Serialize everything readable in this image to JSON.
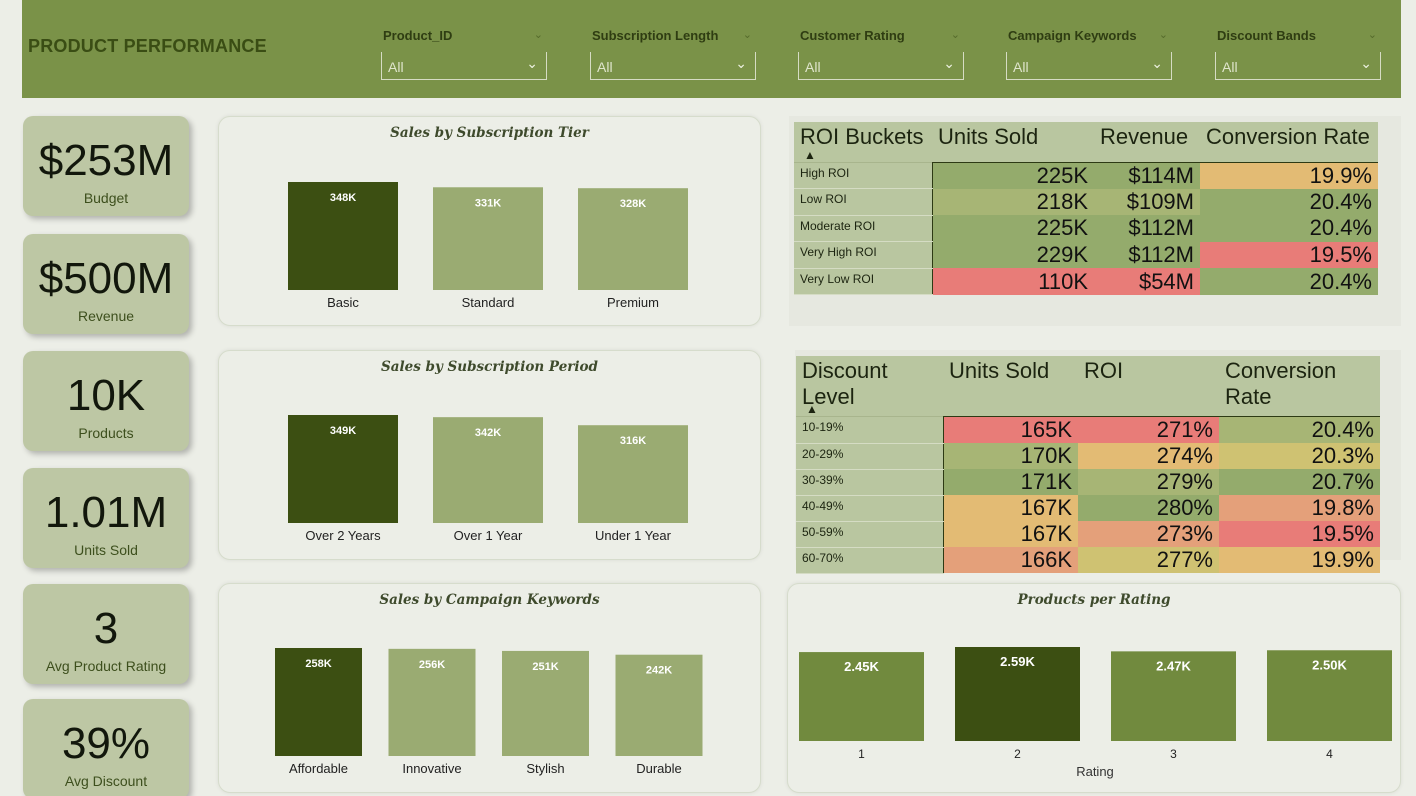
{
  "header": {
    "title": "PRODUCT PERFORMANCE",
    "slicers": [
      {
        "label": "Product_ID",
        "value": "All"
      },
      {
        "label": "Subscription Length",
        "value": "All"
      },
      {
        "label": "Customer Rating",
        "value": "All"
      },
      {
        "label": "Campaign Keywords",
        "value": "All"
      },
      {
        "label": "Discount Bands",
        "value": "All"
      }
    ]
  },
  "kpis": [
    {
      "value": "$253M",
      "label": "Budget"
    },
    {
      "value": "$500M",
      "label": "Revenue"
    },
    {
      "value": "10K",
      "label": "Products"
    },
    {
      "value": "1.01M",
      "label": "Units Sold"
    },
    {
      "value": "3",
      "label": "Avg Product Rating"
    },
    {
      "value": "39%",
      "label": "Avg Discount"
    }
  ],
  "colors": {
    "header": "#7a9248",
    "bar_dark": "#3c4f12",
    "bar_light": "#9aab72",
    "bar_rating": "#718a3e",
    "kpi_card": "#bdc7a4",
    "heat_green": "#94ab6c",
    "heat_olive": "#a7b575",
    "heat_orange": "#e3bb74",
    "heat_red": "#e87c78",
    "heat_salmon": "#e4a07a",
    "heat_yellow": "#cfc272"
  },
  "chart_data": [
    {
      "type": "bar",
      "title": "Sales by Subscription Tier",
      "categories": [
        "Basic",
        "Standard",
        "Premium"
      ],
      "values": [
        348,
        331,
        328
      ],
      "labels": [
        "348K",
        "331K",
        "328K"
      ],
      "highlight": 0,
      "ylim": [
        0,
        348
      ]
    },
    {
      "type": "bar",
      "title": "Sales by Subscription Period",
      "categories": [
        "Over 2 Years",
        "Over 1 Year",
        "Under 1 Year"
      ],
      "values": [
        349,
        342,
        316
      ],
      "labels": [
        "349K",
        "342K",
        "316K"
      ],
      "highlight": 0,
      "ylim": [
        0,
        349
      ]
    },
    {
      "type": "bar",
      "title": "Sales by Campaign Keywords",
      "categories": [
        "Affordable",
        "Innovative",
        "Stylish",
        "Durable"
      ],
      "values": [
        258,
        256,
        251,
        242
      ],
      "labels": [
        "258K",
        "256K",
        "251K",
        "242K"
      ],
      "highlight": 0,
      "ylim": [
        0,
        258
      ]
    },
    {
      "type": "bar",
      "title": "Products per Rating",
      "xlabel": "Rating",
      "categories": [
        "1",
        "2",
        "3",
        "4"
      ],
      "values": [
        2.45,
        2.59,
        2.47,
        2.5
      ],
      "labels": [
        "2.45K",
        "2.59K",
        "2.47K",
        "2.50K"
      ],
      "highlight": 1,
      "ylim": [
        0,
        2.59
      ]
    },
    {
      "type": "table",
      "columns": [
        "ROI Buckets",
        "Units Sold",
        "Revenue",
        "Conversion Rate"
      ],
      "rows": [
        {
          "label": "High ROI",
          "cells": [
            {
              "v": "225K",
              "c": "#94ab6c"
            },
            {
              "v": "$114M",
              "c": "#94ab6c"
            },
            {
              "v": "19.9%",
              "c": "#e3bb74"
            }
          ]
        },
        {
          "label": "Low ROI",
          "cells": [
            {
              "v": "218K",
              "c": "#a7b575"
            },
            {
              "v": "$109M",
              "c": "#a7b575"
            },
            {
              "v": "20.4%",
              "c": "#94ab6c"
            }
          ]
        },
        {
          "label": "Moderate ROI",
          "cells": [
            {
              "v": "225K",
              "c": "#94ab6c"
            },
            {
              "v": "$112M",
              "c": "#94ab6c"
            },
            {
              "v": "20.4%",
              "c": "#94ab6c"
            }
          ]
        },
        {
          "label": "Very High ROI",
          "cells": [
            {
              "v": "229K",
              "c": "#94ab6c"
            },
            {
              "v": "$112M",
              "c": "#94ab6c"
            },
            {
              "v": "19.5%",
              "c": "#e87c78"
            }
          ]
        },
        {
          "label": "Very Low ROI",
          "cells": [
            {
              "v": "110K",
              "c": "#e87c78"
            },
            {
              "v": "$54M",
              "c": "#e87c78"
            },
            {
              "v": "20.4%",
              "c": "#94ab6c"
            }
          ]
        }
      ]
    },
    {
      "type": "table",
      "columns": [
        "Discount Level",
        "Units Sold",
        "ROI",
        "Conversion Rate"
      ],
      "rows": [
        {
          "label": "10-19%",
          "cells": [
            {
              "v": "165K",
              "c": "#e87c78"
            },
            {
              "v": "271%",
              "c": "#e87c78"
            },
            {
              "v": "20.4%",
              "c": "#a7b575"
            }
          ]
        },
        {
          "label": "20-29%",
          "cells": [
            {
              "v": "170K",
              "c": "#a7b575"
            },
            {
              "v": "274%",
              "c": "#e3bb74"
            },
            {
              "v": "20.3%",
              "c": "#cfc272"
            }
          ]
        },
        {
          "label": "30-39%",
          "cells": [
            {
              "v": "171K",
              "c": "#94ab6c"
            },
            {
              "v": "279%",
              "c": "#a7b575"
            },
            {
              "v": "20.7%",
              "c": "#94ab6c"
            }
          ]
        },
        {
          "label": "40-49%",
          "cells": [
            {
              "v": "167K",
              "c": "#e3bb74"
            },
            {
              "v": "280%",
              "c": "#94ab6c"
            },
            {
              "v": "19.8%",
              "c": "#e4a07a"
            }
          ]
        },
        {
          "label": "50-59%",
          "cells": [
            {
              "v": "167K",
              "c": "#e3bb74"
            },
            {
              "v": "273%",
              "c": "#e4a07a"
            },
            {
              "v": "19.5%",
              "c": "#e87c78"
            }
          ]
        },
        {
          "label": "60-70%",
          "cells": [
            {
              "v": "166K",
              "c": "#e4a07a"
            },
            {
              "v": "277%",
              "c": "#cfc272"
            },
            {
              "v": "19.9%",
              "c": "#e3bb74"
            }
          ]
        }
      ]
    }
  ]
}
